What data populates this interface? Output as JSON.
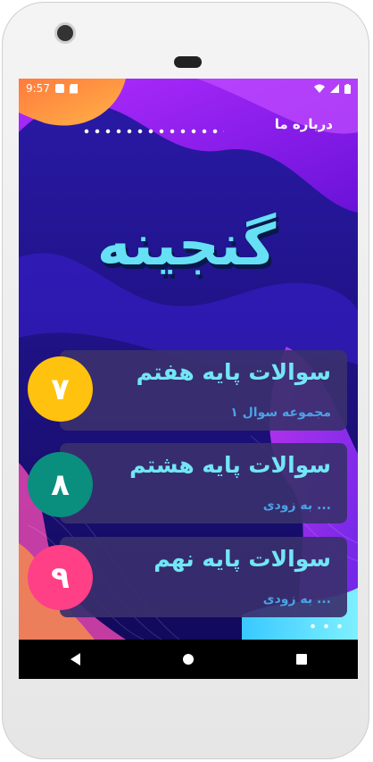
{
  "status_bar": {
    "time": "9:57"
  },
  "header": {
    "about_label": "درباره ما"
  },
  "logo": {
    "text": "گنجینه"
  },
  "cards": [
    {
      "title": "سوالات پایه هفتم",
      "subtitle": "۱ مجموعه سوال",
      "badge": "۷",
      "badge_color": "#ffc20e"
    },
    {
      "title": "سوالات پایه هشتم",
      "subtitle": "به زودی ...",
      "badge": "۸",
      "badge_color": "#0a8f7f"
    },
    {
      "title": "سوالات پایه نهم",
      "subtitle": "به زودی ...",
      "badge": "۹",
      "badge_color": "#ff3f86"
    }
  ],
  "nav": {
    "back_icon": "back-triangle",
    "home_icon": "home-circle",
    "recents_icon": "recents-square"
  }
}
